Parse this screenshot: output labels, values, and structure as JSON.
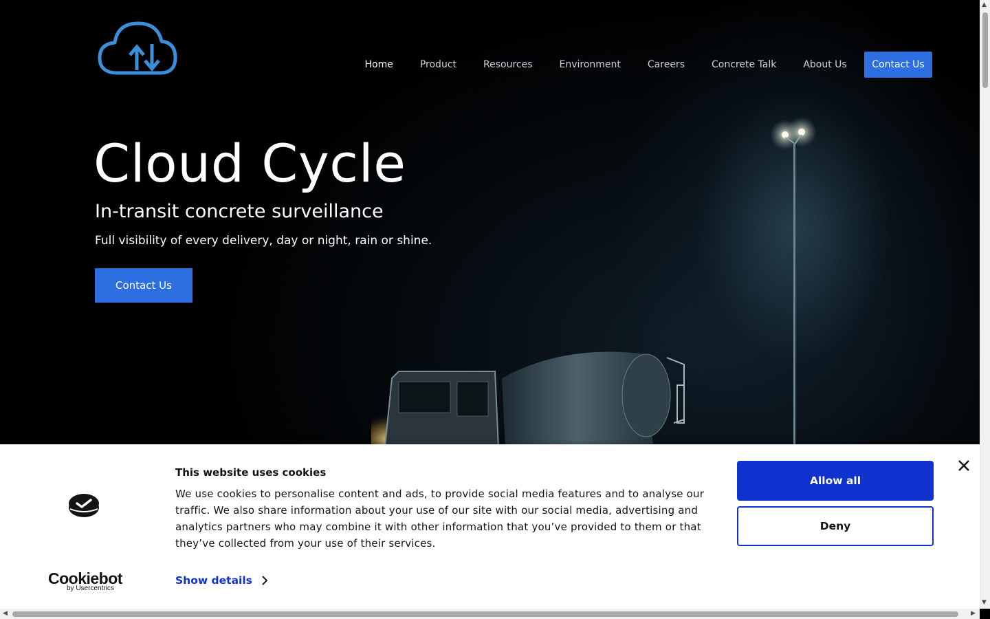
{
  "colors": {
    "accent": "#2d6fe0",
    "cookiebot_blue": "#1032cf",
    "logo_blue": "#3b8fd8"
  },
  "logo": {
    "icon": "cloud-cycle-icon"
  },
  "nav": {
    "items": [
      {
        "label": "Home",
        "active": true
      },
      {
        "label": "Product"
      },
      {
        "label": "Resources"
      },
      {
        "label": "Environment"
      },
      {
        "label": "Careers"
      },
      {
        "label": "Concrete Talk"
      },
      {
        "label": "About Us"
      }
    ],
    "cta_label": "Contact Us"
  },
  "hero": {
    "title": "Cloud Cycle",
    "subtitle": "In-transit concrete surveillance",
    "description": "Full visibility of every delivery, day or night, rain or shine.",
    "cta_label": "Contact Us"
  },
  "cookie_banner": {
    "brand": "Cookiebot",
    "brand_by": "by Usercentrics",
    "title": "This website uses cookies",
    "body": "We use cookies to personalise content and ads, to provide social media features and to analyse our traffic. We also share information about your use of our site with our social media, advertising and analytics partners who may combine it with other information that you’ve provided to them or that they’ve collected from your use of their services.",
    "details_label": "Show details",
    "allow_label": "Allow all",
    "deny_label": "Deny"
  }
}
